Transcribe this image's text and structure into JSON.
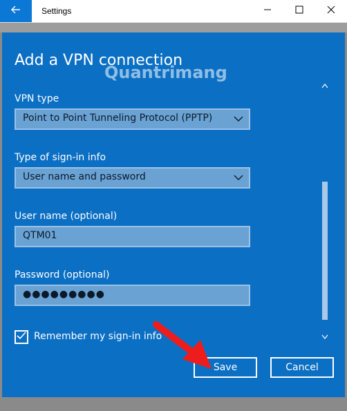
{
  "window": {
    "title": "Settings",
    "accent_color": "#0a78d4"
  },
  "dialog": {
    "title": "Add a VPN connection",
    "background_color": "#0b6fc4",
    "watermark": "Quantrimang",
    "fields": {
      "vpn_type": {
        "label": "VPN type",
        "value": "Point to Point Tunneling Protocol (PPTP)"
      },
      "sign_in_type": {
        "label": "Type of sign-in info",
        "value": "User name and password"
      },
      "username": {
        "label": "User name (optional)",
        "value": "QTM01"
      },
      "password": {
        "label": "Password (optional)",
        "value": "●●●●●●●●●"
      }
    },
    "remember": {
      "label": "Remember my sign-in info",
      "checked": true
    },
    "buttons": {
      "save": "Save",
      "cancel": "Cancel"
    }
  },
  "icons": {
    "back": "back-arrow-icon",
    "minimize": "minimize-icon",
    "maximize": "maximize-icon",
    "close": "close-icon",
    "dropdown": "chevron-down-icon",
    "check": "checkmark-icon"
  }
}
